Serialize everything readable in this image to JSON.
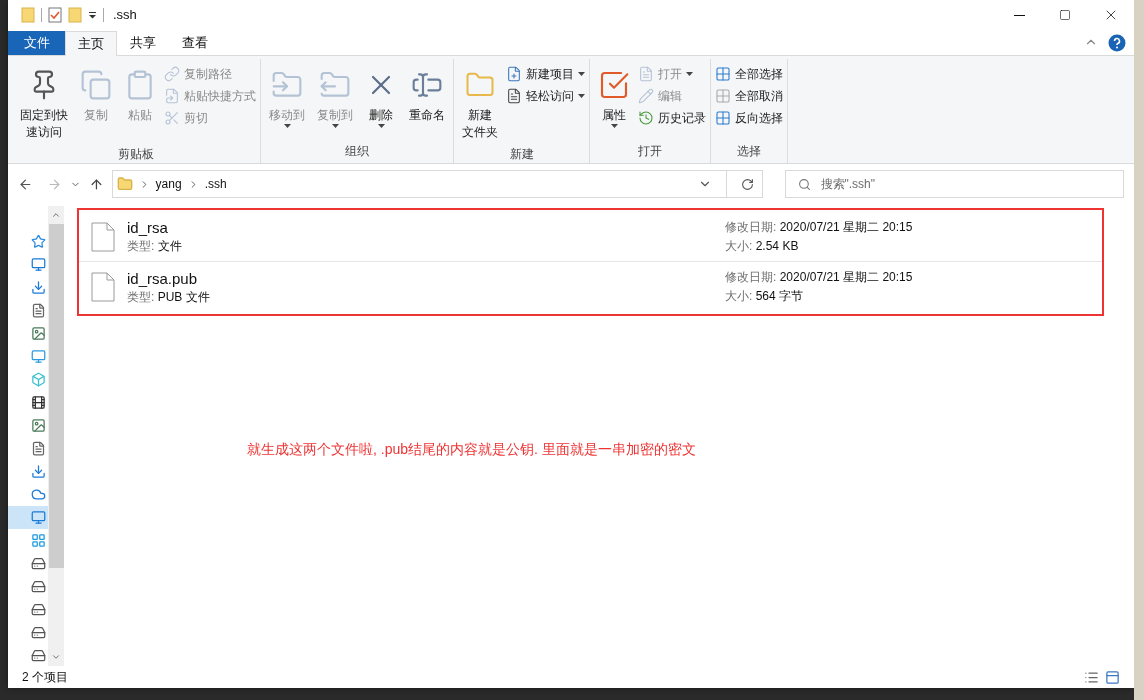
{
  "window": {
    "title": ".ssh"
  },
  "quick_access": [
    {
      "kind": "folder"
    },
    {
      "kind": "properties"
    },
    {
      "kind": "folder"
    },
    {
      "kind": "dropdown"
    }
  ],
  "tabs": [
    {
      "label": "文件",
      "kind": "file",
      "selected": false
    },
    {
      "label": "主页",
      "kind": "tab",
      "selected": true
    },
    {
      "label": "共享",
      "kind": "tab",
      "selected": false
    },
    {
      "label": "查看",
      "kind": "tab",
      "selected": false
    }
  ],
  "ribbon": [
    {
      "label": "剪贴板",
      "big": [
        {
          "kind": "pin",
          "lines": [
            "固定到快",
            "速访问"
          ],
          "disabled": false,
          "dropdown": false
        },
        {
          "kind": "copy",
          "lines": [
            "复制"
          ],
          "disabled": true,
          "dropdown": false
        },
        {
          "kind": "paste",
          "lines": [
            "粘贴"
          ],
          "disabled": true,
          "dropdown": false
        }
      ],
      "small": [
        {
          "kind": "path",
          "label": "复制路径",
          "disabled": true,
          "dropdown": false
        },
        {
          "kind": "shortcut",
          "label": "粘贴快捷方式",
          "disabled": true,
          "dropdown": false
        },
        {
          "kind": "cut",
          "label": "剪切",
          "disabled": true,
          "dropdown": false
        }
      ]
    },
    {
      "label": "组织",
      "big": [
        {
          "kind": "move",
          "lines": [
            "移动到"
          ],
          "disabled": true,
          "dropdown": true
        },
        {
          "kind": "copyto",
          "lines": [
            "复制到"
          ],
          "disabled": true,
          "dropdown": true
        },
        {
          "kind": "delete",
          "lines": [
            "删除"
          ],
          "disabled": false,
          "dropdown": true
        },
        {
          "kind": "rename",
          "lines": [
            "重命名"
          ],
          "disabled": false,
          "dropdown": false
        }
      ]
    },
    {
      "label": "新建",
      "big": [
        {
          "kind": "folder",
          "lines": [
            "新建",
            "文件夹"
          ],
          "disabled": false,
          "dropdown": false
        }
      ],
      "small": [
        {
          "kind": "newitem",
          "label": "新建项目",
          "disabled": false,
          "dropdown": true
        },
        {
          "kind": "easy",
          "label": "轻松访问",
          "disabled": false,
          "dropdown": true
        }
      ]
    },
    {
      "label": "打开",
      "big": [
        {
          "kind": "props",
          "lines": [
            "属性"
          ],
          "disabled": false,
          "dropdown": true
        }
      ],
      "small": [
        {
          "kind": "open",
          "label": "打开",
          "disabled": true,
          "dropdown": true
        },
        {
          "kind": "edit",
          "label": "编辑",
          "disabled": true,
          "dropdown": false
        },
        {
          "kind": "history",
          "label": "历史记录",
          "disabled": false,
          "dropdown": false
        }
      ]
    },
    {
      "label": "选择",
      "small": [
        {
          "kind": "selall",
          "label": "全部选择",
          "disabled": false,
          "dropdown": false
        },
        {
          "kind": "selnone",
          "label": "全部取消",
          "disabled": false,
          "dropdown": false
        },
        {
          "kind": "selinv",
          "label": "反向选择",
          "disabled": false,
          "dropdown": false
        }
      ]
    }
  ],
  "address": {
    "path": [
      "yang",
      ".ssh"
    ],
    "search_placeholder": "搜索\".ssh\""
  },
  "nav_pane": [
    {
      "kind": "star",
      "selected": false
    },
    {
      "kind": "desktop",
      "selected": false
    },
    {
      "kind": "download",
      "selected": false
    },
    {
      "kind": "doc",
      "selected": false
    },
    {
      "kind": "image",
      "selected": false
    },
    {
      "kind": "pc",
      "selected": false
    },
    {
      "kind": "cube",
      "selected": false
    },
    {
      "kind": "video",
      "selected": false
    },
    {
      "kind": "image",
      "selected": false
    },
    {
      "kind": "doc",
      "selected": false
    },
    {
      "kind": "download",
      "selected": false
    },
    {
      "kind": "cloud",
      "selected": false
    },
    {
      "kind": "desktop",
      "selected": true
    },
    {
      "kind": "windows",
      "selected": false
    },
    {
      "kind": "drive",
      "selected": false
    },
    {
      "kind": "drive",
      "selected": false
    },
    {
      "kind": "drive",
      "selected": false
    },
    {
      "kind": "drive",
      "selected": false
    },
    {
      "kind": "drive",
      "selected": false
    }
  ],
  "files": [
    {
      "name": "id_rsa",
      "type_label": "类型:",
      "type": "文件",
      "date_label": "修改日期:",
      "date": "2020/07/21 星期二 20:15",
      "size_label": "大小:",
      "size": "2.54 KB"
    },
    {
      "name": "id_rsa.pub",
      "type_label": "类型:",
      "type": "PUB 文件",
      "date_label": "修改日期:",
      "date": "2020/07/21 星期二 20:15",
      "size_label": "大小:",
      "size": "564 字节"
    }
  ],
  "annotation": "就生成这两个文件啦, .pub结尾的内容就是公钥. 里面就是一串加密的密文",
  "status_bar": {
    "count": "2 个项目"
  }
}
